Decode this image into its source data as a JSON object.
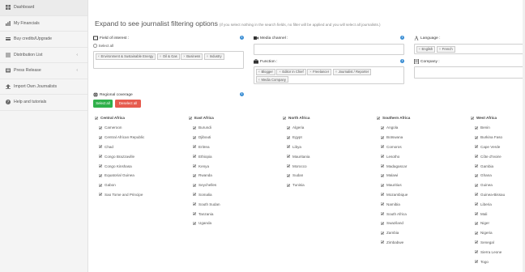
{
  "sidebar": {
    "items": [
      {
        "label": "Dashboard",
        "icon": "dashboard-icon"
      },
      {
        "label": "My Financials",
        "icon": "financials-icon"
      },
      {
        "label": "Buy credits/Upgrade",
        "icon": "credit-card-icon"
      },
      {
        "label": "Distribution List",
        "icon": "list-icon",
        "caret": "‹"
      },
      {
        "label": "Press Release",
        "icon": "press-icon",
        "caret": "‹"
      },
      {
        "label": "Import Own Journalists",
        "icon": "upload-icon"
      },
      {
        "label": "Help and tutorials",
        "icon": "help-icon"
      }
    ]
  },
  "heading": {
    "title": "Expand to see journalist filtering options",
    "hint": "(if you select nothing in the search fields, no filter will be applied and you will select all journalists.)"
  },
  "field_of_interest": {
    "label": "Field of interest :",
    "select_all": "Select all",
    "tags": [
      "Environment & Sustainable Energy",
      "Oil & Gas",
      "Business",
      "Industry"
    ]
  },
  "media_channel": {
    "label": "Media channel :",
    "value": ""
  },
  "function": {
    "label": "Function :",
    "tags": [
      "Blogger",
      "Editor in Chief",
      "Freelancer",
      "Journalist / Reporter",
      "Media Company"
    ]
  },
  "language": {
    "label": "Language :",
    "tags": [
      "English",
      "French"
    ]
  },
  "company": {
    "label": "Company :",
    "value": ""
  },
  "regional_coverage": {
    "label": "Regional coverage",
    "select_all": "Select all",
    "deselect_all": "Deselect all"
  },
  "regions": [
    {
      "name": "Central Africa",
      "countries": [
        "Cameroon",
        "Central African Republic",
        "Chad",
        "Congo Brazzaville",
        "Congo Kinshasa",
        "Equatorial Guinea",
        "Gabon",
        "Sao Tome and Principe"
      ]
    },
    {
      "name": "East Africa",
      "countries": [
        "Burundi",
        "Djibouti",
        "Eritrea",
        "Ethiopia",
        "Kenya",
        "Rwanda",
        "Seychelles",
        "Somalia",
        "South Sudan",
        "Tanzania",
        "Uganda"
      ]
    },
    {
      "name": "North Africa",
      "countries": [
        "Algeria",
        "Egypt",
        "Libya",
        "Mauritania",
        "Morocco",
        "Sudan",
        "Tunisia"
      ]
    },
    {
      "name": "Southern Africa",
      "countries": [
        "Angola",
        "Botswana",
        "Comoros",
        "Lesotho",
        "Madagascar",
        "Malawi",
        "Mauritius",
        "Mozambique",
        "Namibia",
        "South Africa",
        "Swaziland",
        "Zambia",
        "Zimbabwe"
      ]
    },
    {
      "name": "West Africa",
      "countries": [
        "Benin",
        "Burkina Faso",
        "Cape Verde",
        "Côte d'Ivoire",
        "Gambia",
        "Ghana",
        "Guinea",
        "Guinea-Bissau",
        "Liberia",
        "Mali",
        "Niger",
        "Nigeria",
        "Senegal",
        "Sierra Leone",
        "Togo"
      ]
    }
  ],
  "colors": {
    "accent": "#3d8fd4",
    "select_all_button": "#2fb04a",
    "deselect_all_button": "#e65c4f"
  }
}
